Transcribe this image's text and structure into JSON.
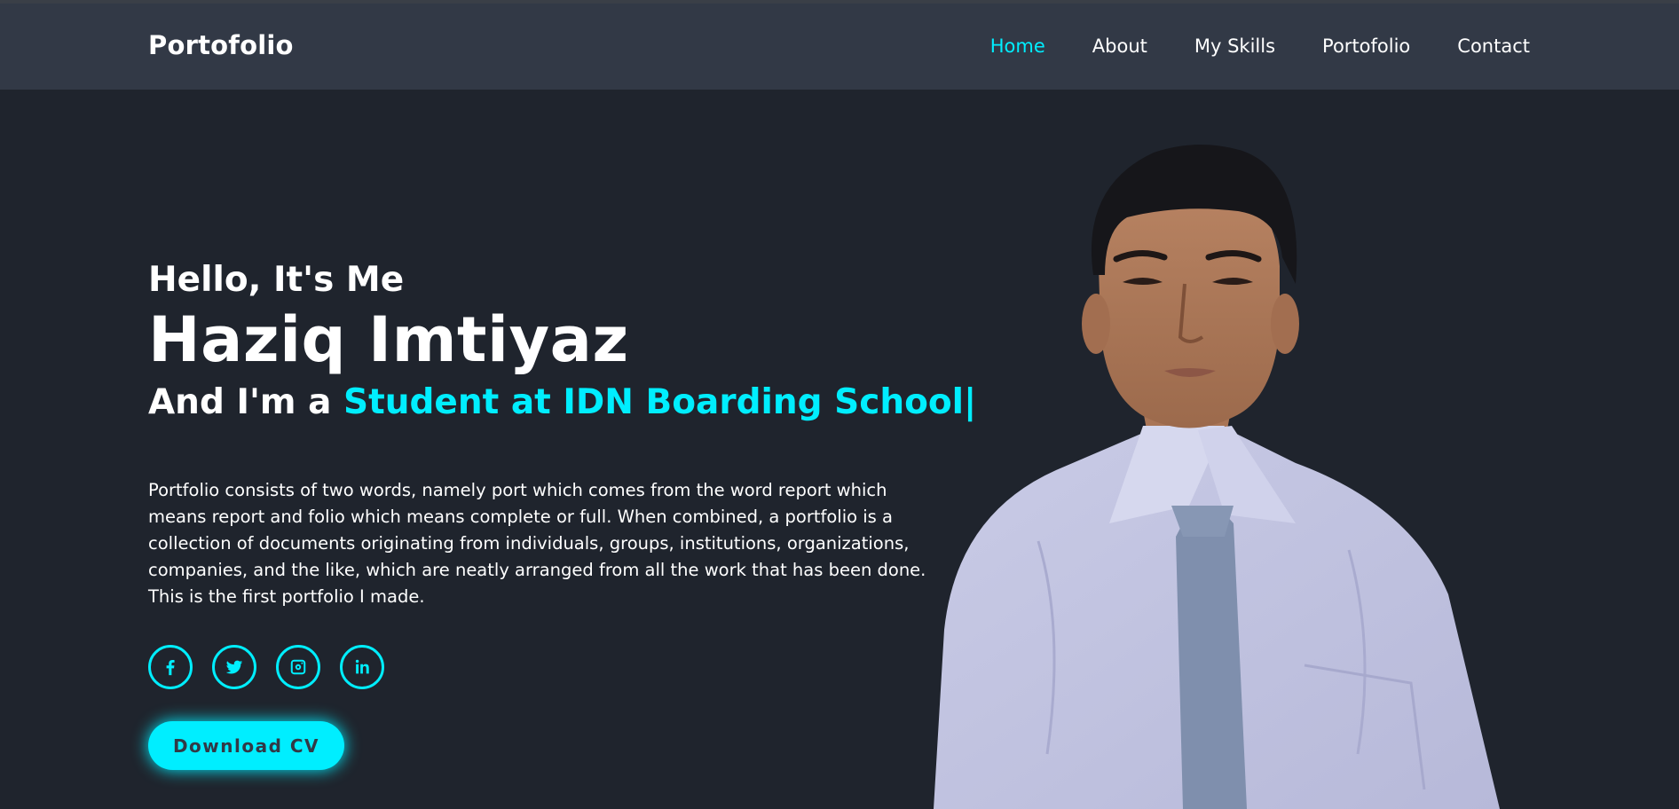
{
  "header": {
    "logo": "Portofolio",
    "nav": [
      {
        "label": "Home",
        "active": true
      },
      {
        "label": "About"
      },
      {
        "label": "My Skills"
      },
      {
        "label": "Portofolio"
      },
      {
        "label": "Contact"
      }
    ]
  },
  "hero": {
    "greeting": "Hello, It's Me",
    "name": "Haziq Imtiyaz",
    "role_prefix": "And I'm a",
    "role_highlight": "Student at IDN Boarding School",
    "typing_cursor": "|",
    "bio": "Portfolio consists of two words, namely port which comes from the word report which means report and folio which means complete or full. When combined, a portfolio is a collection of documents originating from individuals, groups, institutions, organizations, companies, and the like, which are neatly arranged from all the work that has been done. This is the first portfolio I made.",
    "socials": [
      {
        "icon": "facebook-icon"
      },
      {
        "icon": "twitter-icon"
      },
      {
        "icon": "instagram-icon"
      },
      {
        "icon": "linkedin-icon"
      }
    ],
    "cv_button": "Download CV"
  },
  "colors": {
    "background": "#1f242d",
    "header": "#323946",
    "accent": "#00eeff",
    "text": "#ffffff"
  }
}
